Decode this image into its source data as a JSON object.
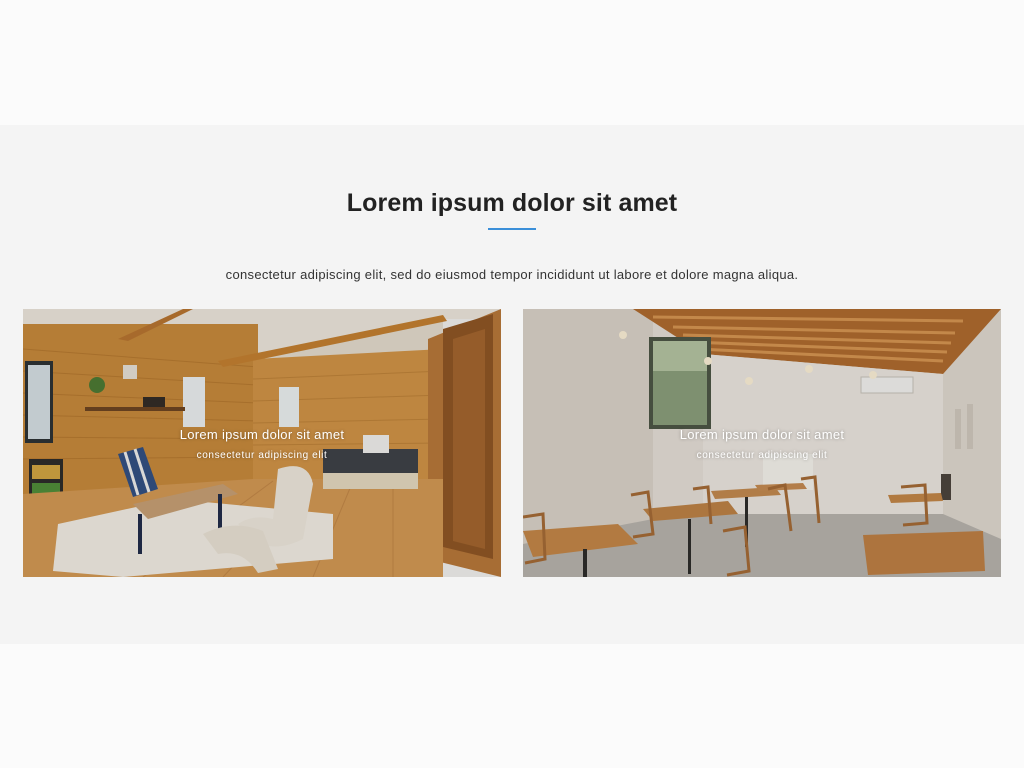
{
  "section": {
    "title": "Lorem ipsum dolor sit amet",
    "subtitle": "consectetur adipiscing elit, sed do eiusmod tempor incididunt ut labore et dolore magna aliqua.",
    "accent_color": "#3b8fd9"
  },
  "cards": [
    {
      "title": "Lorem ipsum dolor sit amet",
      "subtitle": "consectetur adipiscing elit",
      "image": "wooden-living-room-photo"
    },
    {
      "title": "Lorem ipsum dolor sit amet",
      "subtitle": "consectetur adipiscing elit",
      "image": "cafe-dining-room-photo"
    }
  ]
}
